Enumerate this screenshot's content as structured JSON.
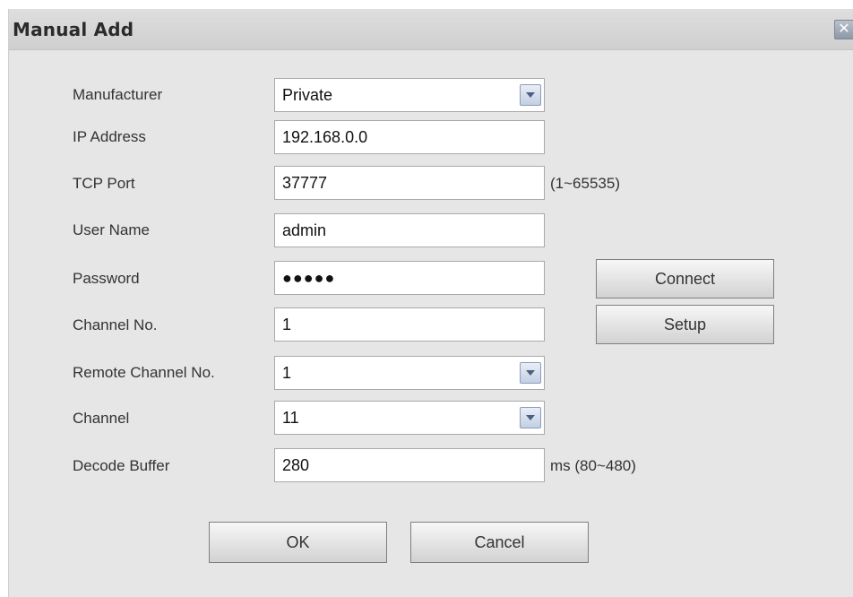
{
  "dialog": {
    "title": "Manual Add",
    "close_icon": "close-icon"
  },
  "form": {
    "manufacturer": {
      "label": "Manufacturer",
      "value": "Private"
    },
    "ip_address": {
      "label": "IP Address",
      "value": "192.168.0.0"
    },
    "tcp_port": {
      "label": "TCP Port",
      "value": "37777",
      "hint": "(1~65535)"
    },
    "user_name": {
      "label": "User Name",
      "value": "admin"
    },
    "password": {
      "label": "Password",
      "value": "●●●●●"
    },
    "channel_no": {
      "label": "Channel No.",
      "value": "1"
    },
    "remote_channel_no": {
      "label": "Remote Channel No.",
      "value": "1"
    },
    "channel": {
      "label": "Channel",
      "value": "11"
    },
    "decode_buffer": {
      "label": "Decode Buffer",
      "value": "280",
      "hint": "ms (80~480)"
    }
  },
  "buttons": {
    "connect": "Connect",
    "setup": "Setup",
    "ok": "OK",
    "cancel": "Cancel"
  }
}
